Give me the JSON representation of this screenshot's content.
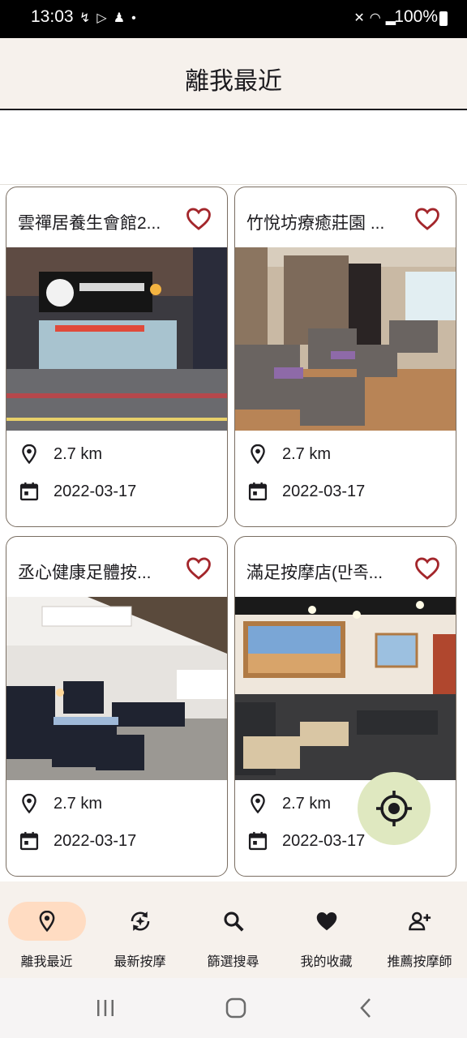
{
  "status_bar": {
    "time": "13:03",
    "left_icons": [
      "missed-call-icon",
      "play-store-icon",
      "figure-icon",
      "dot-icon"
    ],
    "right_icons": [
      "mute-icon",
      "wifi-icon",
      "signal-icon"
    ],
    "battery": "100%"
  },
  "app_bar": {
    "title": "離我最近"
  },
  "cards": [
    {
      "title": "雲禪居養生會館2...",
      "distance": "2.7 km",
      "date": "2022-03-17",
      "favorite_icon": "heart-outline-icon"
    },
    {
      "title": "竹悅坊療癒莊園 ...",
      "distance": "2.7 km",
      "date": "2022-03-17",
      "favorite_icon": "heart-outline-icon"
    },
    {
      "title": "丞心健康足體按...",
      "distance": "2.7 km",
      "date": "2022-03-17",
      "favorite_icon": "heart-outline-icon"
    },
    {
      "title": "滿足按摩店(만족...",
      "distance": "2.7 km",
      "date": "2022-03-17",
      "favorite_icon": "heart-outline-icon"
    }
  ],
  "fab": {
    "icon": "locate-crosshair-icon"
  },
  "bottom_nav": [
    {
      "label": "離我最近",
      "icon": "location-pin-icon",
      "active": true
    },
    {
      "label": "最新按摩",
      "icon": "refresh-sparkle-icon",
      "active": false
    },
    {
      "label": "篩選搜尋",
      "icon": "search-icon",
      "active": false
    },
    {
      "label": "我的收藏",
      "icon": "heart-icon",
      "active": false
    },
    {
      "label": "推薦按摩師",
      "icon": "add-person-icon",
      "active": false
    }
  ],
  "colors": {
    "accent_heart": "#a3262b",
    "app_bar_bg": "#f6f1ec",
    "active_pill": "#ffdcc2",
    "fab_bg": "#dfe8c0",
    "card_border": "#7a6e62"
  }
}
